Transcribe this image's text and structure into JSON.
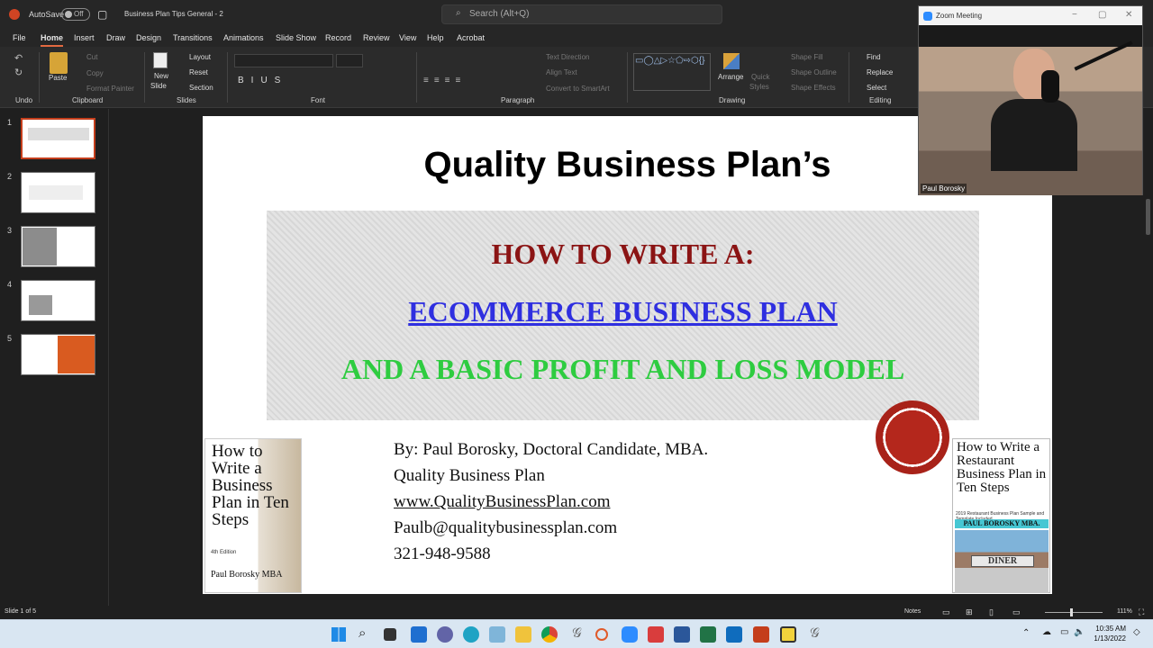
{
  "titlebar": {
    "autosave_label": "AutoSave",
    "autosave_state": "Off",
    "document_title": "Business Plan Tips General - 2",
    "search_placeholder": "Search (Alt+Q)"
  },
  "menu": [
    "File",
    "Home",
    "Insert",
    "Draw",
    "Design",
    "Transitions",
    "Animations",
    "Slide Show",
    "Record",
    "Review",
    "View",
    "Help",
    "Acrobat"
  ],
  "ribbon": {
    "clipboard": {
      "paste": "Paste",
      "cut": "Cut",
      "copy": "Copy",
      "format_painter": "Format Painter",
      "group": "Clipboard"
    },
    "undo_group": "Undo",
    "slides": {
      "new_slide": "New",
      "new_slide_2": "Slide",
      "layout": "Layout",
      "reset": "Reset",
      "section": "Section",
      "group": "Slides"
    },
    "font_group": "Font",
    "paragraph": {
      "text_direction": "Text Direction",
      "align_text": "Align Text",
      "convert_smartart": "Convert to SmartArt",
      "group": "Paragraph"
    },
    "drawing": {
      "arrange": "Arrange",
      "quick": "Quick",
      "styles": "Styles",
      "shape_fill": "Shape Fill",
      "shape_outline": "Shape Outline",
      "shape_effects": "Shape Effects",
      "group": "Drawing"
    },
    "editing": {
      "find": "Find",
      "replace": "Replace",
      "select": "Select",
      "group": "Editing"
    }
  },
  "thumbnails": [
    "1",
    "2",
    "3",
    "4",
    "5"
  ],
  "slide": {
    "title": "Quality Business Plan’s",
    "banner_line1": "HOW TO WRITE A:",
    "banner_line2": "ECOMMERCE BUSINESS PLAN",
    "banner_line3": "AND A BASIC PROFIT AND LOSS MODEL",
    "contact_by": "By: Paul Borosky, Doctoral Candidate, MBA.",
    "contact_company": "Quality Business Plan",
    "contact_website": "www.QualityBusinessPlan.com",
    "contact_email": "Paulb@qualitybusinessplan.com",
    "contact_phone": "321-948-9588",
    "book_left": {
      "title": "How to Write a Business Plan in Ten Steps",
      "edition": "4th Edition",
      "author": "Paul Borosky MBA"
    },
    "book_right": {
      "title": "How to Write a Restaurant Business Plan in Ten Steps",
      "subtitle": "2019 Restaurant Business Plan Sample and Template Included",
      "author": "PAUL BOROSKY MBA.",
      "sign": "DINER"
    }
  },
  "statusbar": {
    "slide_counter": "Slide 1 of 5",
    "notes": "Notes",
    "zoom_level": "111%"
  },
  "zoom": {
    "window_title": "Zoom Meeting",
    "participant_name": "Paul Borosky"
  },
  "taskbar": {
    "time": "10:35 AM",
    "date": "1/13/2022"
  }
}
